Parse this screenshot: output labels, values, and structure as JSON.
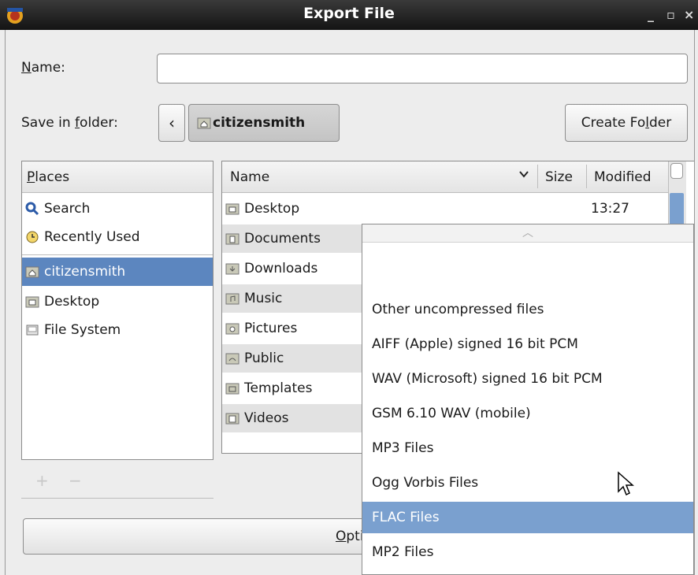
{
  "window": {
    "title": "Export File",
    "minimize": "_",
    "maximize": "▫",
    "close": "×"
  },
  "name_row": {
    "label_u": "N",
    "label_rest": "ame:",
    "value": ""
  },
  "folder_row": {
    "label_pre": "Save in ",
    "label_u": "f",
    "label_post": "older:",
    "back": "‹",
    "current": "citizensmith",
    "create_pre": "Create Fo",
    "create_u": "l",
    "create_post": "der"
  },
  "places": {
    "header_u": "P",
    "header_rest": "laces",
    "items": [
      {
        "label": "Search",
        "icon": "search-icon"
      },
      {
        "label": "Recently Used",
        "icon": "clock-icon"
      },
      {
        "label": "citizensmith",
        "icon": "home-folder-icon",
        "selected": true
      },
      {
        "label": "Desktop",
        "icon": "folder-icon"
      },
      {
        "label": "File System",
        "icon": "drive-icon"
      }
    ],
    "add": "+",
    "remove": "−"
  },
  "files": {
    "columns": {
      "name": "Name",
      "size": "Size",
      "modified": "Modified"
    },
    "rows": [
      {
        "name": "Desktop",
        "modified": "13:27"
      },
      {
        "name": "Documents",
        "modified": ""
      },
      {
        "name": "Downloads",
        "modified": ""
      },
      {
        "name": "Music",
        "modified": ""
      },
      {
        "name": "Pictures",
        "modified": ""
      },
      {
        "name": "Public",
        "modified": ""
      },
      {
        "name": "Templates",
        "modified": ""
      },
      {
        "name": "Videos",
        "modified": ""
      }
    ]
  },
  "options_button": {
    "u": "O",
    "rest": "ptio"
  },
  "format_menu": {
    "scroll_up": "︿",
    "items": [
      {
        "label": "Other uncompressed files"
      },
      {
        "label": "AIFF (Apple) signed 16 bit PCM"
      },
      {
        "label": "WAV (Microsoft) signed 16 bit PCM"
      },
      {
        "label": "GSM 6.10 WAV (mobile)"
      },
      {
        "label": "MP3 Files"
      },
      {
        "label": "Ogg Vorbis Files"
      },
      {
        "label": "FLAC Files",
        "selected": true
      },
      {
        "label": "MP2 Files"
      }
    ]
  },
  "colors": {
    "selection": "#5c86bf",
    "menu_selection": "#7aa0cf",
    "titlebar": "#1e1e1e"
  }
}
